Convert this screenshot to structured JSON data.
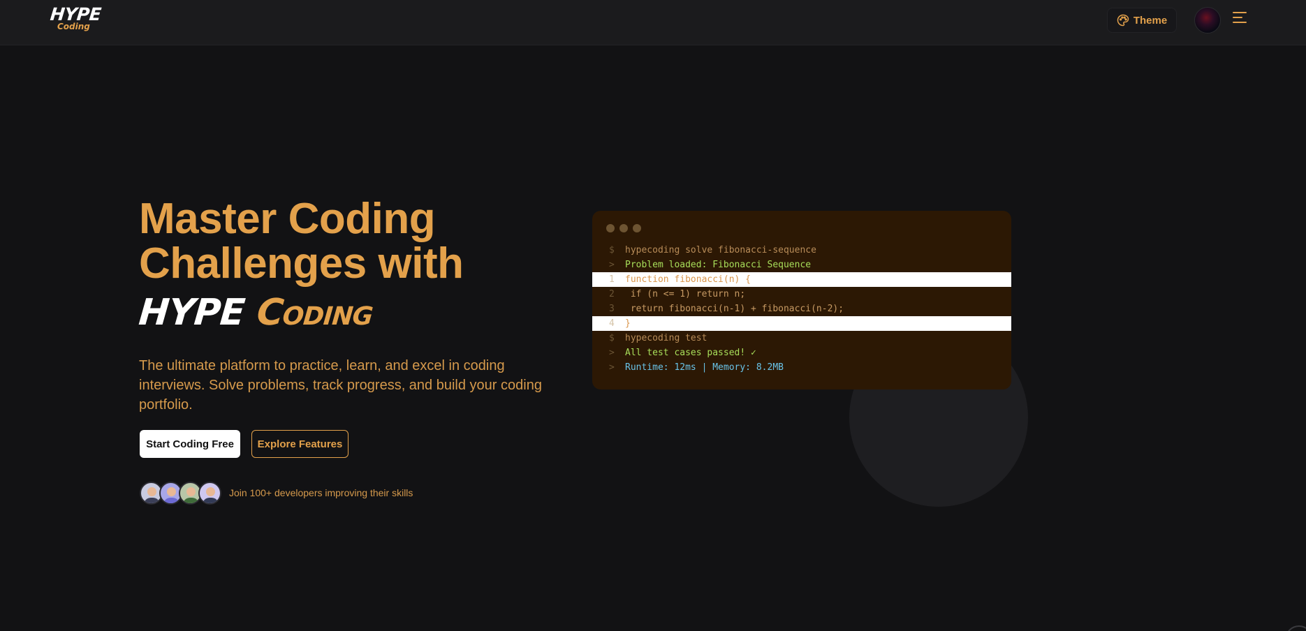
{
  "nav": {
    "logo_top": "HYPE",
    "logo_bottom": "Coding",
    "theme_label": "Theme"
  },
  "hero": {
    "title_line1": "Master Coding",
    "title_line2": "Challenges with",
    "brand_word1": "HYPE",
    "brand_word2": "Coding",
    "subtitle": "The ultimate platform to practice, learn, and excel in coding interviews. Solve problems, track progress, and build your coding portfolio.",
    "primary_cta": "Start Coding Free",
    "secondary_cta": "Explore Features",
    "social_proof": "Join 100+ developers improving their skills"
  },
  "terminal": {
    "lines": [
      {
        "gutter": "$",
        "text": "hypecoding solve fibonacci-sequence"
      },
      {
        "gutter": ">",
        "text": "Problem loaded: Fibonacci Sequence"
      },
      {
        "gutter": "1",
        "text": "function fibonacci(n) {"
      },
      {
        "gutter": "2",
        "text": " if (n <= 1) return n;"
      },
      {
        "gutter": "3",
        "text": " return fibonacci(n-1) + fibonacci(n-2);"
      },
      {
        "gutter": "4",
        "text": "}"
      },
      {
        "gutter": "$",
        "text": "hypecoding test"
      },
      {
        "gutter": ">",
        "text": "All test cases passed! ✓"
      },
      {
        "gutter": ">",
        "text": "Runtime: 12ms | Memory: 8.2MB"
      }
    ]
  },
  "colors": {
    "accent": "#e3a14b",
    "background": "#121214",
    "terminal_bg": "#2c1804",
    "success": "#a8df5a",
    "info": "#69c3e8"
  },
  "icons": {
    "theme": "palette-icon",
    "menu": "hamburger-menu-icon"
  }
}
